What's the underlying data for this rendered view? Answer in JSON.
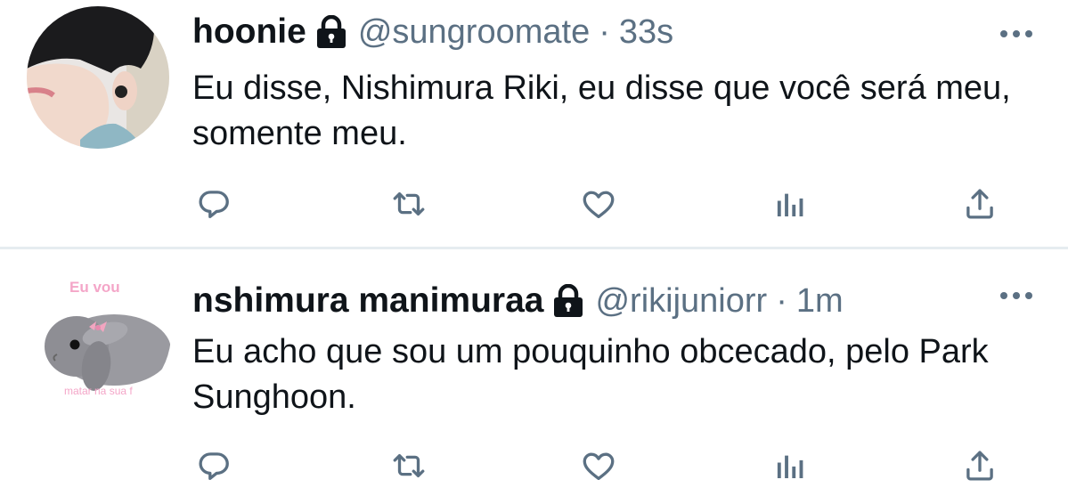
{
  "colors": {
    "text": "#0f1419",
    "secondary": "#5b7083",
    "divider": "#e6ecf0",
    "background": "#ffffff"
  },
  "tweets": [
    {
      "display_name": "hoonie",
      "handle": "@sungroomate",
      "separator": "·",
      "time": "33s",
      "text": "Eu disse, Nishimura Riki, eu disse que você será meu, somente meu.",
      "avatar": "boy-photo-avatar",
      "protected": true,
      "avatar_text": {}
    },
    {
      "display_name": "nshimura manimuraa",
      "handle": "@rikijuniorr",
      "separator": "·",
      "time": "1m",
      "text": "Eu acho que sou um pouquinho obcecado, pelo Park Sunghoon.",
      "avatar": "bunny-photo-avatar",
      "protected": true,
      "avatar_text": {
        "top": "Eu vou",
        "bottom": "matar na sua f"
      }
    }
  ],
  "actions": [
    "reply-icon",
    "retweet-icon",
    "like-icon",
    "analytics-icon",
    "share-icon"
  ]
}
